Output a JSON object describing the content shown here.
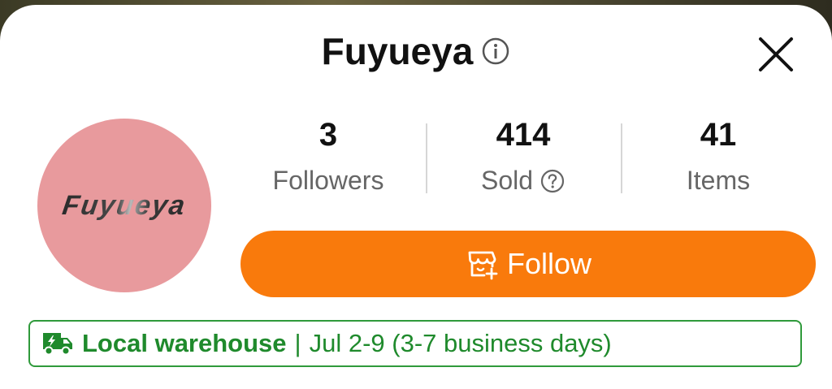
{
  "shop": {
    "name": "Fuyueya",
    "avatar_text": "Fuyueya"
  },
  "stats": [
    {
      "value": "3",
      "label": "Followers"
    },
    {
      "value": "414",
      "label": "Sold"
    },
    {
      "value": "41",
      "label": "Items"
    }
  ],
  "follow_button": {
    "label": "Follow"
  },
  "shipping": {
    "type": "Local warehouse",
    "separator": "|",
    "date": "Jul 2-9 (3-7 business days)"
  },
  "colors": {
    "accent": "#f97a0c",
    "shipping_green": "#1f8a2c",
    "avatar_bg": "#e89a9d"
  },
  "icons": {
    "info": "info-icon",
    "close": "close-icon",
    "help": "question-circle-icon",
    "follow": "store-add-icon",
    "shipping": "truck-lightning-icon"
  }
}
